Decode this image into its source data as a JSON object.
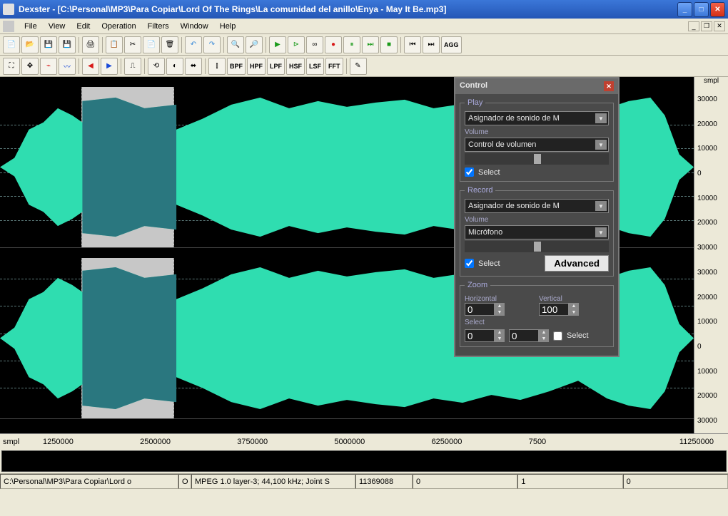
{
  "window": {
    "title": "Dexster - [C:\\Personal\\MP3\\Para Copiar\\Lord Of The Rings\\La comunidad del anillo\\Enya - May It Be.mp3]"
  },
  "menu": {
    "items": [
      "File",
      "View",
      "Edit",
      "Operation",
      "Filters",
      "Window",
      "Help"
    ]
  },
  "toolbar2_text": [
    "BPF",
    "HPF",
    "LPF",
    "HSF",
    "LSF",
    "FFT",
    "AGG"
  ],
  "scale": {
    "label": "smpl",
    "ticks": [
      "30000",
      "20000",
      "10000",
      "0",
      "10000",
      "20000",
      "30000"
    ]
  },
  "timeline": {
    "label": "smpl",
    "ticks": [
      "1250000",
      "2500000",
      "3750000",
      "5000000",
      "6250000",
      "7500",
      "",
      "11250000"
    ]
  },
  "statusbar": {
    "path": "C:\\Personal\\MP3\\Para Copiar\\Lord o",
    "format_prefix": "O",
    "format": "MPEG 1.0 layer-3; 44,100 kHz; Joint S",
    "samples": "11369088",
    "p1": "0",
    "p2": "1",
    "p3": "0"
  },
  "control": {
    "title": "Control",
    "play": {
      "legend": "Play",
      "device": "Asignador de sonido de M",
      "volume_label": "Volume",
      "volume_device": "Control de volumen",
      "select": "Select"
    },
    "record": {
      "legend": "Record",
      "device": "Asignador de sonido de M",
      "volume_label": "Volume",
      "volume_device": "Micrófono",
      "select": "Select",
      "advanced": "Advanced"
    },
    "zoom": {
      "legend": "Zoom",
      "horizontal_label": "Horizontal",
      "vertical_label": "Vertical",
      "horizontal": "0",
      "vertical": "100",
      "select_label": "Select",
      "select_a": "0",
      "select_b": "0",
      "select_check": "Select"
    }
  }
}
